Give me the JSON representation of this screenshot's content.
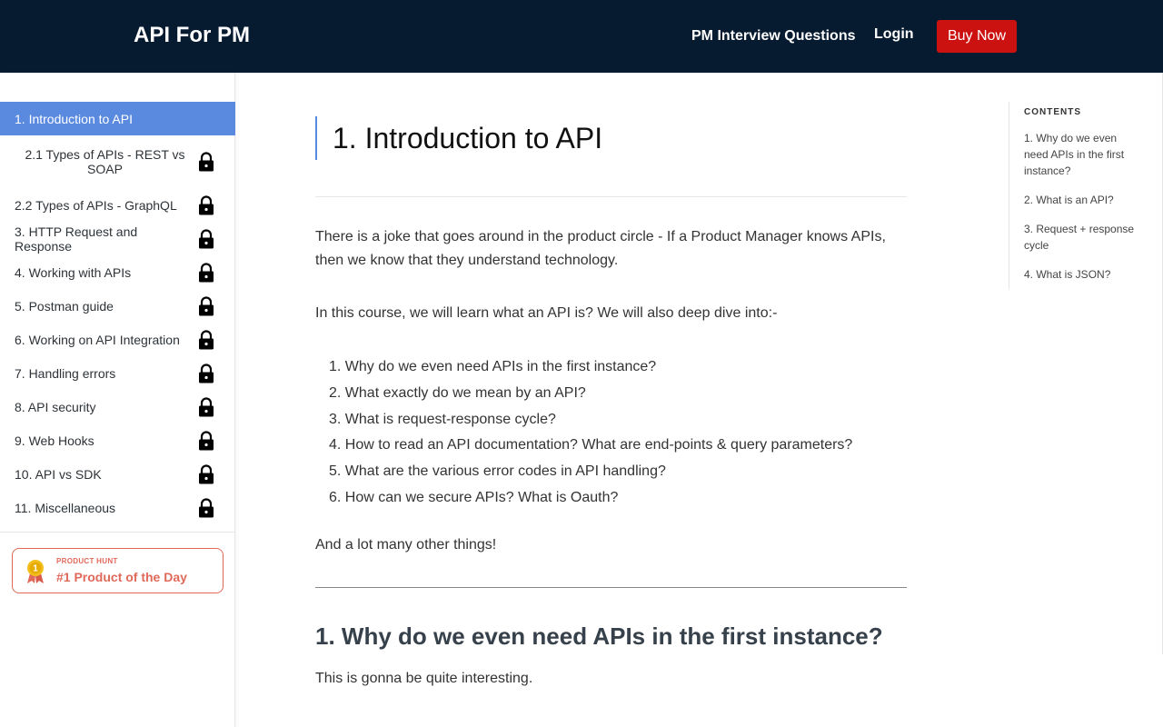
{
  "header": {
    "brand": "API For PM",
    "nav_questions": "PM Interview Questions",
    "nav_login": "Login",
    "buy_now": "Buy Now"
  },
  "sidebar": {
    "items": [
      {
        "label": "1. Introduction to API",
        "locked": false,
        "active": true
      },
      {
        "label": "2.1 Types of APIs - REST vs SOAP",
        "locked": true
      },
      {
        "label": "2.2 Types of APIs - GraphQL",
        "locked": true
      },
      {
        "label": "3. HTTP Request and Response",
        "locked": true
      },
      {
        "label": "4. Working with APIs",
        "locked": true
      },
      {
        "label": "5. Postman guide",
        "locked": true
      },
      {
        "label": "6. Working on API Integration",
        "locked": true
      },
      {
        "label": "7. Handling errors",
        "locked": true
      },
      {
        "label": "8. API security",
        "locked": true
      },
      {
        "label": "9. Web Hooks",
        "locked": true
      },
      {
        "label": "10. API vs SDK",
        "locked": true
      },
      {
        "label": "11. Miscellaneous",
        "locked": true
      }
    ],
    "badge": {
      "label": "PRODUCT HUNT",
      "title": "#1 Product of the Day",
      "medal_number": "1",
      "color": "#e0695a"
    }
  },
  "main": {
    "title": "1. Introduction to API",
    "intro": "There is a joke that goes around in the product circle - If a Product Manager knows APIs, then we know that they understand technology.",
    "course_intro": "In this course, we will learn what an API is? We will also deep dive into:-",
    "topics": [
      "1. Why do we even need APIs in the first instance?",
      "2. What exactly do we mean by an API?",
      "3. What is request-response cycle?",
      "4. How to read an API documentation? What are end-points & query parameters?",
      "5. What are the various error codes in API handling?",
      "6. How can we secure APIs? What is Oauth?"
    ],
    "closing": "And a lot many other things!",
    "section_title": "1. Why do we even need APIs in the first instance?",
    "section_intro": "This is gonna be quite interesting."
  },
  "toc": {
    "heading": "CONTENTS",
    "items": [
      "1. Why do we even need APIs in the first instance?",
      "2. What is an API?",
      "3. Request + response cycle",
      "4. What is JSON?"
    ]
  },
  "colors": {
    "header_bg": "#061a30",
    "accent": "#5a8ae0",
    "buy_button": "#cc1111"
  }
}
